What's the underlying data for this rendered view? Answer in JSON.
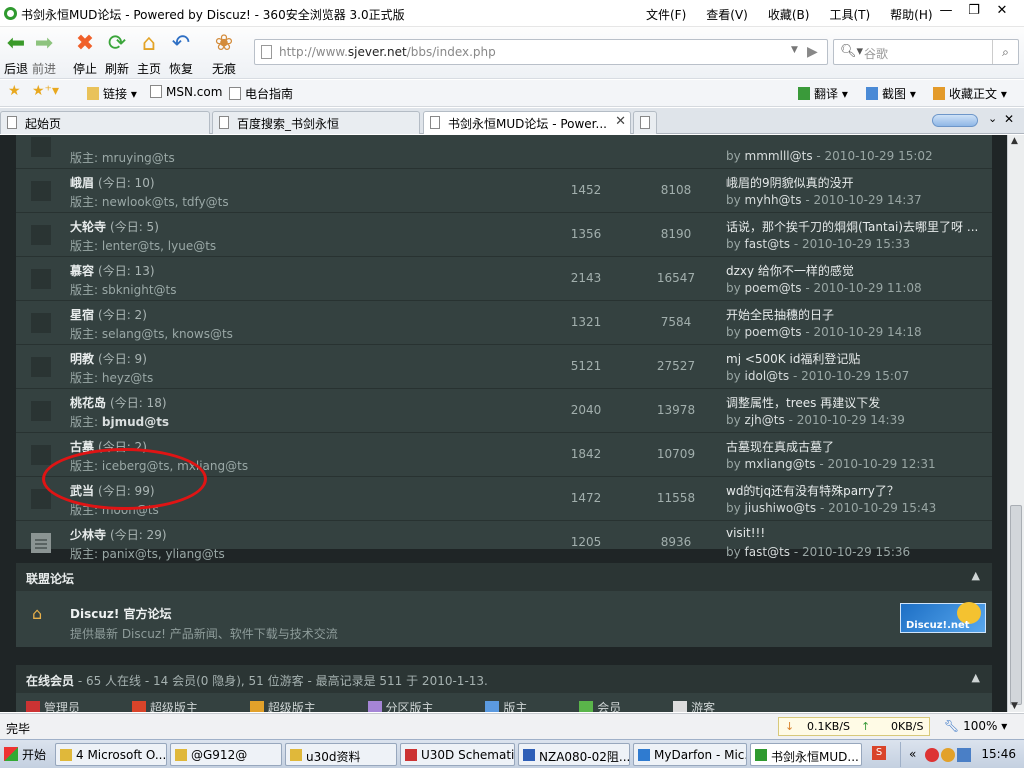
{
  "window": {
    "title": "书剑永恒MUD论坛 - Powered by Discuz! - 360安全浏览器 3.0正式版",
    "menus": [
      "文件(F)",
      "查看(V)",
      "收藏(B)",
      "工具(T)",
      "帮助(H)"
    ]
  },
  "toolbar": {
    "back": "后退",
    "forward": "前进",
    "stop": "停止",
    "refresh": "刷新",
    "home": "主页",
    "restore": "恢复",
    "incognito": "无痕"
  },
  "address": {
    "prefix": "http://www.",
    "domain": "sjever.net",
    "path": "/bbs/index.php"
  },
  "search": {
    "placeholder": "谷歌"
  },
  "favorites": {
    "links": "链接",
    "msn": "MSN.com",
    "radio": "电台指南",
    "translate": "翻译",
    "screenshot": "截图",
    "collect": "收藏正文"
  },
  "tabs": [
    {
      "label": "起始页"
    },
    {
      "label": "百度搜索_书剑永恒"
    },
    {
      "label": "书剑永恒MUD论坛 - Power..."
    }
  ],
  "forums": [
    {
      "name": "",
      "today": "",
      "mods_prefix": "版主: ",
      "mods": "mruying@ts",
      "topics": "",
      "posts": "",
      "last_title": "",
      "last_by": "mmmlll@ts",
      "last_time": " - 2010-10-29 15:02",
      "new": false
    },
    {
      "name": "峨眉",
      "today": "(今日: 10)",
      "mods_prefix": "版主: ",
      "mods": "newlook@ts, tdfy@ts",
      "topics": "1452",
      "posts": "8108",
      "last_title": "峨眉的9阴貌似真的没开",
      "last_by": "myhh@ts",
      "last_time": " - 2010-10-29 14:37",
      "new": false
    },
    {
      "name": "大轮寺",
      "today": "(今日: 5)",
      "mods_prefix": "版主: ",
      "mods": "lenter@ts, lyue@ts",
      "topics": "1356",
      "posts": "8190",
      "last_title": "话说，那个挨千刀的烔烔(Tantai)去哪里了呀 ...",
      "last_by": "fast@ts",
      "last_time": " - 2010-10-29 15:33",
      "new": false
    },
    {
      "name": "慕容",
      "today": "(今日: 13)",
      "mods_prefix": "版主: ",
      "mods": "sbknight@ts",
      "topics": "2143",
      "posts": "16547",
      "last_title": "dzxy 给你不一样的感觉",
      "last_by": "poem@ts",
      "last_time": " - 2010-10-29 11:08",
      "new": false
    },
    {
      "name": "星宿",
      "today": "(今日: 2)",
      "mods_prefix": "版主: ",
      "mods": "selang@ts, knows@ts",
      "topics": "1321",
      "posts": "7584",
      "last_title": "开始全民抽穗的日子",
      "last_by": "poem@ts",
      "last_time": " - 2010-10-29 14:18",
      "new": false
    },
    {
      "name": "明教",
      "today": "(今日: 9)",
      "mods_prefix": "版主: ",
      "mods": "heyz@ts",
      "topics": "5121",
      "posts": "27527",
      "last_title": "mj <500K id福利登记贴",
      "last_by": "idol@ts",
      "last_time": " - 2010-10-29 15:07",
      "new": false
    },
    {
      "name": "桃花岛",
      "today": "(今日: 18)",
      "mods_prefix": "版主: ",
      "mods": "bjmud@ts",
      "topics": "2040",
      "posts": "13978",
      "last_title": "调整属性，trees 再建议下发",
      "last_by": "zjh@ts",
      "last_time": " - 2010-10-29 14:39",
      "new": false
    },
    {
      "name": "古墓",
      "today": "(今日: 2)",
      "mods_prefix": "版主: ",
      "mods": "iceberg@ts, mxliang@ts",
      "topics": "1842",
      "posts": "10709",
      "last_title": "古墓现在真成古墓了",
      "last_by": "mxliang@ts",
      "last_time": " - 2010-10-29 12:31",
      "new": false
    },
    {
      "name": "武当",
      "today": "(今日: 99)",
      "mods_prefix": "版主: ",
      "mods": "moon@ts",
      "topics": "1472",
      "posts": "11558",
      "last_title": "wd的tjq还有没有特殊parry了？",
      "last_by": "jiushiwo@ts",
      "last_time": " - 2010-10-29 15:43",
      "new": false
    },
    {
      "name": "少林寺",
      "today": "(今日: 29)",
      "mods_prefix": "版主: ",
      "mods": "panix@ts, yliang@ts",
      "topics": "1205",
      "posts": "8936",
      "last_title": "visit!!!",
      "last_by": "fast@ts",
      "last_time": " - 2010-10-29 15:36",
      "new": true
    }
  ],
  "league": {
    "title": "联盟论坛",
    "forum_name": "Discuz! 官方论坛",
    "forum_desc": "提供最新  Discuz! 产品新闻、软件下载与技术交流",
    "logo_text": "Discuz!.net"
  },
  "online": {
    "title": "在线会员",
    "summary": " - 65 人在线  - 14 会员(0 隐身), 51 位游客  - 最高记录是  511 于  2010-1-13.",
    "legend": [
      "管理员",
      "超级版主",
      "超级版主",
      "分区版主",
      "版主",
      "会员",
      "游客"
    ]
  },
  "status": {
    "text": "完毕",
    "down": "0.1KB/S",
    "up": "0KB/S",
    "zoom": "100%"
  },
  "taskbar": {
    "start": "开始",
    "items": [
      "4 Microsoft O...",
      "@G912@",
      "u30d资料",
      "U30D Schemati...",
      "NZA080-02阻...",
      "MyDarfon - Mic...",
      "书剑永恒MUD..."
    ],
    "clock": "15:46"
  },
  "colors": {
    "page_bg": "#1f2526",
    "row_bg": "#344140",
    "highlight_circle": "#e01414"
  }
}
